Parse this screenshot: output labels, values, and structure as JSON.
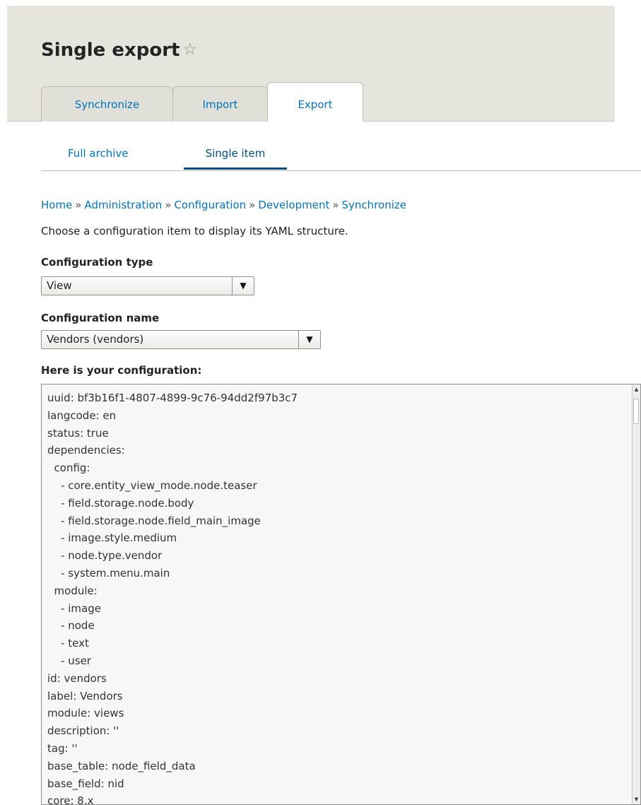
{
  "header": {
    "title": "Single export",
    "star_icon": "☆"
  },
  "primary_tabs": [
    {
      "label": "Synchronize",
      "active": false
    },
    {
      "label": "Import",
      "active": false
    },
    {
      "label": "Export",
      "active": true
    }
  ],
  "secondary_tabs": [
    {
      "label": "Full archive",
      "active": false
    },
    {
      "label": "Single item",
      "active": true
    }
  ],
  "breadcrumb": {
    "items": [
      "Home",
      "Administration",
      "Configuration",
      "Development",
      "Synchronize"
    ],
    "separator": "»"
  },
  "description": "Choose a configuration item to display its YAML structure.",
  "config_type": {
    "label": "Configuration type",
    "value": "View",
    "arrow_icon": "▼"
  },
  "config_name": {
    "label": "Configuration name",
    "value": "Vendors (vendors)",
    "arrow_icon": "▼"
  },
  "output": {
    "label": "Here is your configuration:",
    "text": "uuid: bf3b16f1-4807-4899-9c76-94dd2f97b3c7\nlangcode: en\nstatus: true\ndependencies:\n  config:\n    - core.entity_view_mode.node.teaser\n    - field.storage.node.body\n    - field.storage.node.field_main_image\n    - image.style.medium\n    - node.type.vendor\n    - system.menu.main\n  module:\n    - image\n    - node\n    - text\n    - user\nid: vendors\nlabel: Vendors\nmodule: views\ndescription: ''\ntag: ''\nbase_table: node_field_data\nbase_field: nid\ncore: 8.x"
  },
  "scrollbar": {
    "up_icon": "▲",
    "down_icon": "▼"
  }
}
